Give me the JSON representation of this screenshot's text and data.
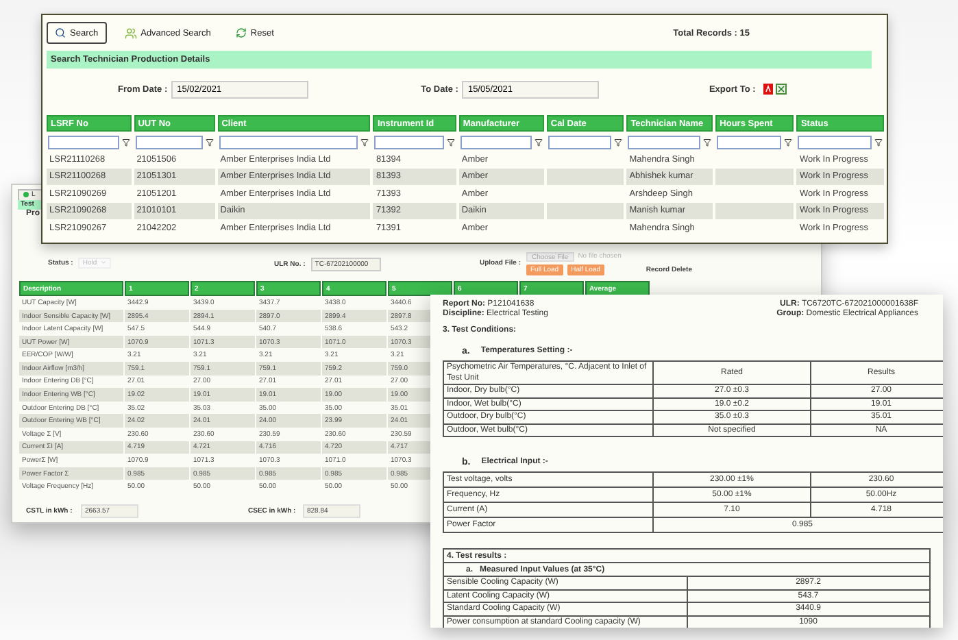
{
  "search_window": {
    "toolbar": [
      {
        "kind": "search",
        "label": "Search"
      },
      {
        "kind": "advanced",
        "label": "Advanced Search"
      },
      {
        "kind": "reset",
        "label": "Reset"
      }
    ],
    "total_records": "Total Records : 15",
    "panel_title": "Search Technician Production Details",
    "from_label": "From Date :",
    "from_value": "15/02/2021",
    "to_label": "To Date :",
    "to_value": "15/05/2021",
    "export_label": "Export To :",
    "table": {
      "columns": [
        "LSRF No",
        "UUT No",
        "Client",
        "Instrument Id",
        "Manufacturer",
        "Cal Date",
        "Technician Name",
        "Hours Spent",
        "Status"
      ],
      "rows": [
        [
          "LSR21110268",
          "21051506",
          "Amber Enterprises India Ltd",
          "81394",
          "Amber",
          "",
          "Mahendra Singh",
          "",
          "Work In Progress"
        ],
        [
          "LSR21100268",
          "21051301",
          "Amber Enterprises India Ltd",
          "81393",
          "Amber",
          "",
          "Abhishek kumar",
          "",
          "Work In Progress"
        ],
        [
          "LSR21090269",
          "21051201",
          "Amber Enterprises India Ltd",
          "71393",
          "Amber",
          "",
          "Arshdeep Singh",
          "",
          "Work In Progress"
        ],
        [
          "LSR21090268",
          "21010101",
          "Daikin",
          "71392",
          "Daikin",
          "",
          "Manish kumar",
          "",
          "Work In Progress"
        ],
        [
          "LSR21090267",
          "21042202",
          "Amber Enterprises India Ltd",
          "71391",
          "Amber",
          "",
          "Mahendra Singh",
          "",
          "Work In Progress"
        ]
      ]
    }
  },
  "test_window": {
    "tab": "L",
    "bar": "Test",
    "heading": "Pro",
    "status_label": "Status :",
    "status_value": "Hold",
    "ulr_label": "ULR No. :",
    "ulr_value": "TC-67202100000",
    "upload_label": "Upload File :",
    "choose_file": "Choose File",
    "no_file": "No file chosen",
    "load_buttons": [
      "Full Load",
      "Half Load"
    ],
    "record_delete": "Record Delete",
    "table": {
      "columns": [
        "Description",
        "1",
        "2",
        "3",
        "4",
        "5",
        "6",
        "7",
        "Average"
      ],
      "rows": [
        {
          "description": "UUT Capacity [W]",
          "values": [
            "3442.9",
            "3439.0",
            "3437.7",
            "3438.0",
            "3440.6"
          ]
        },
        {
          "description": "Indoor Sensible Capacity [W]",
          "values": [
            "2895.4",
            "2894.1",
            "2897.0",
            "2899.4",
            "2897.8"
          ]
        },
        {
          "description": "Indoor Latent Capacity [W]",
          "values": [
            "547.5",
            "544.9",
            "540.7",
            "538.6",
            "543.2"
          ]
        },
        {
          "description": "UUT Power [W]",
          "values": [
            "1070.9",
            "1071.3",
            "1070.3",
            "1071.0",
            "1070.3"
          ]
        },
        {
          "description": "EER/COP [W/W]",
          "values": [
            "3.21",
            "3.21",
            "3.21",
            "3.21",
            "3.21"
          ]
        },
        {
          "description": "Indoor Airflow [m3/h]",
          "values": [
            "759.1",
            "759.1",
            "759.1",
            "759.2",
            "759.0"
          ]
        },
        {
          "description": "Indoor Entering DB [°C]",
          "values": [
            "27.01",
            "27.00",
            "27.01",
            "27.01",
            "27.00"
          ]
        },
        {
          "description": "Indoor Entering WB [°C]",
          "values": [
            "19.02",
            "19.01",
            "19.01",
            "19.00",
            "19.00"
          ]
        },
        {
          "description": "Outdoor Entering DB [°C]",
          "values": [
            "35.02",
            "35.03",
            "35.00",
            "35.00",
            "35.01"
          ]
        },
        {
          "description": "Outdoor Entering WB [°C]",
          "values": [
            "24.02",
            "24.01",
            "24.00",
            "23.99",
            "24.01"
          ]
        },
        {
          "description": "Voltage Σ [V]",
          "values": [
            "230.60",
            "230.60",
            "230.59",
            "230.60",
            "230.59"
          ]
        },
        {
          "description": "Current ΣI [A]",
          "values": [
            "4.719",
            "4.721",
            "4.716",
            "4.720",
            "4.717"
          ]
        },
        {
          "description": "PowerΣ [W]",
          "values": [
            "1070.9",
            "1071.3",
            "1070.3",
            "1071.0",
            "1070.3"
          ]
        },
        {
          "description": "Power Factor Σ",
          "values": [
            "0.985",
            "0.985",
            "0.985",
            "0.985",
            "0.985"
          ]
        },
        {
          "description": "Voltage Frequency [Hz]",
          "values": [
            "50.00",
            "50.00",
            "50.00",
            "50.00",
            "50.00"
          ]
        }
      ]
    },
    "fields": [
      {
        "label": "CSTL in kWh :",
        "value": "2663.57"
      },
      {
        "label": "CSEC in kWh :",
        "value": "828.84"
      }
    ]
  },
  "report": {
    "report_no_label": "Report No:",
    "report_no": "P121041638",
    "ulr_label": "ULR:",
    "ulr": "TC6720TC-672021000001638F",
    "discipline_label": "Discipline:",
    "discipline": "Electrical Testing",
    "group_label": "Group:",
    "group": "Domestic Electrical Appliances",
    "section3": "3. Test Conditions:",
    "temp_heading": {
      "letter": "a.",
      "title": "Temperatures Setting :-"
    },
    "temp_table": {
      "columns": [
        "Psychometric Air Temperatures, °C. Adjacent to Inlet of Test Unit",
        "Rated",
        "Results"
      ],
      "rows": [
        [
          "Indoor, Dry bulb(°C)",
          "27.0 ±0.3",
          "27.00"
        ],
        [
          "Indoor, Wet bulb(°C)",
          "19.0 ±0.2",
          "19.01"
        ],
        [
          "Outdoor, Dry bulb(°C)",
          "35.0 ±0.3",
          "35.01"
        ],
        [
          "Outdoor, Wet bulb(°C)",
          "Not specified",
          "NA"
        ]
      ]
    },
    "elec_heading": {
      "letter": "b.",
      "title": "Electrical Input :-"
    },
    "elec_table": [
      [
        "Test voltage, volts",
        "230.00 ±1%",
        "230.60"
      ],
      [
        "Frequency, Hz",
        "50.00 ±1%",
        "50.00Hz"
      ],
      [
        "Current (A)",
        "7.10",
        "4.718"
      ],
      [
        "Power Factor",
        "0.985"
      ]
    ],
    "results_title": "4.  Test results :",
    "results_heading": {
      "letter": "a.",
      "title": "Measured Input Values (at 35°C)"
    },
    "results": [
      [
        "Sensible Cooling Capacity (W)",
        "2897.2"
      ],
      [
        "Latent Cooling Capacity (W)",
        "543.7"
      ],
      [
        "Standard Cooling Capacity (W)",
        "3440.9"
      ],
      [
        "Power consumption  at standard Cooling capacity (W)",
        "1090"
      ]
    ]
  }
}
